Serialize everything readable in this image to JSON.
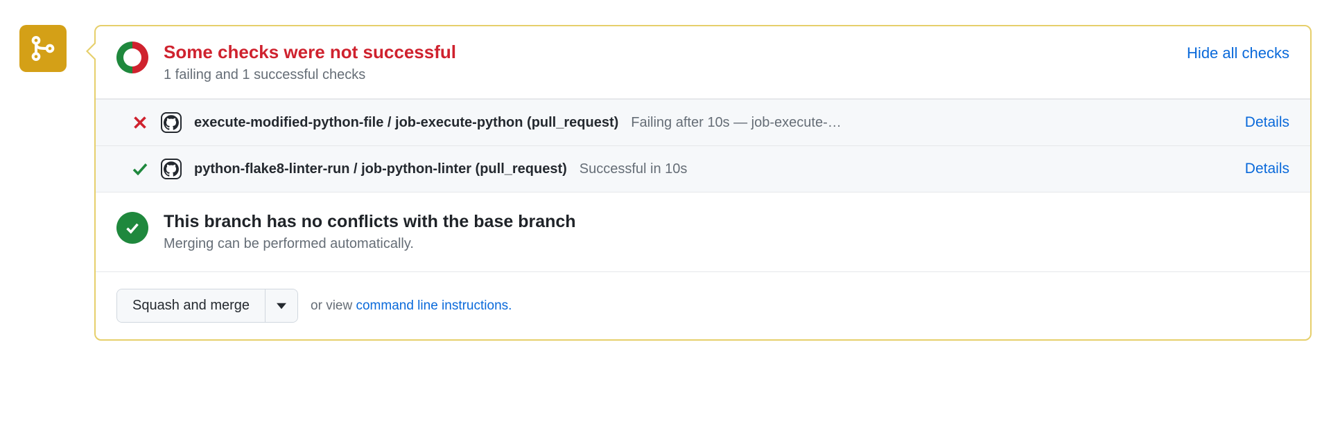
{
  "status": {
    "headline": "Some checks were not successful",
    "summary": "1 failing and 1 successful checks",
    "hide_link": "Hide all checks"
  },
  "checks": [
    {
      "state": "fail",
      "label": "execute-modified-python-file / job-execute-python (pull_request)",
      "meta": "Failing after 10s — job-execute-…",
      "details": "Details"
    },
    {
      "state": "ok",
      "label": "python-flake8-linter-run / job-python-linter (pull_request)",
      "meta": "Successful in 10s",
      "details": "Details"
    }
  ],
  "conflicts": {
    "title": "This branch has no conflicts with the base branch",
    "subtitle": "Merging can be performed automatically."
  },
  "merge": {
    "button": "Squash and merge",
    "orview": "or view ",
    "cli_link": "command line instructions."
  }
}
